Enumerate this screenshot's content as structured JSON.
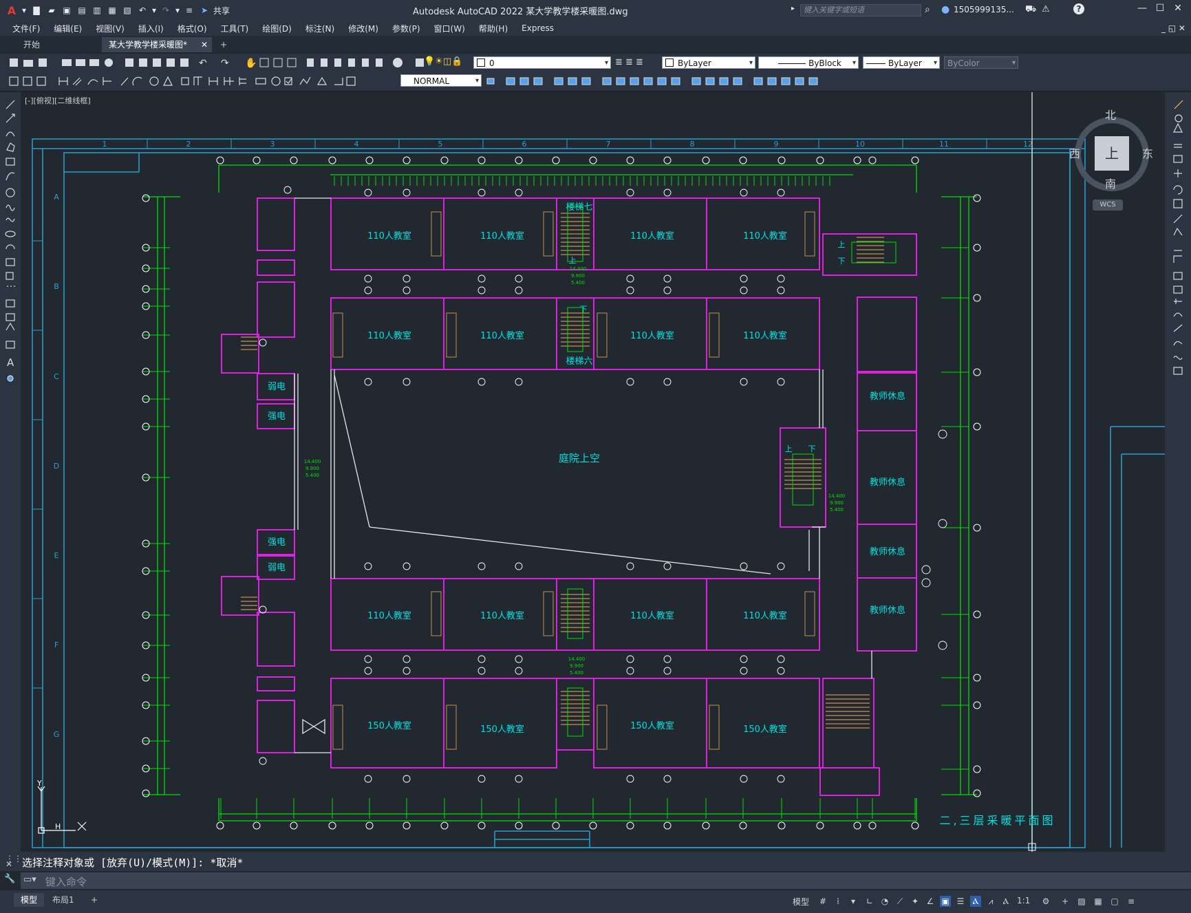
{
  "app": {
    "title": "Autodesk AutoCAD 2022    某大学教学楼采暖图.dwg",
    "logo": "A",
    "share_label": "共享",
    "search_placeholder": "键入关键字或短语",
    "user": "1505999135...",
    "help_icon": "?"
  },
  "menu": [
    "文件(F)",
    "编辑(E)",
    "视图(V)",
    "插入(I)",
    "格式(O)",
    "工具(T)",
    "绘图(D)",
    "标注(N)",
    "修改(M)",
    "参数(P)",
    "窗口(W)",
    "帮助(H)",
    "Express"
  ],
  "tabs": {
    "start": "开始",
    "active": "某大学教学楼采暖图*"
  },
  "properties": {
    "layer": "0",
    "color": "ByLayer",
    "linetype": "ByBlock",
    "lineweight": "ByLayer",
    "plotstyle": "ByColor",
    "visual_style": "NORMAL"
  },
  "viewport": {
    "label": "[-][俯视][二维线框]"
  },
  "viewcube": {
    "north": "北",
    "south": "南",
    "east": "东",
    "west": "西",
    "top": "上",
    "wcs": "WCS"
  },
  "drawing": {
    "column_labels": [
      "1",
      "2",
      "3",
      "4",
      "5",
      "6",
      "7",
      "8",
      "9",
      "10",
      "11",
      "12"
    ],
    "row_labels": [
      "A",
      "B",
      "C",
      "D",
      "E",
      "F",
      "G"
    ],
    "rooms": [
      "110人教室",
      "110人教室",
      "110人教室",
      "110人教室",
      "110人教室",
      "110人教室",
      "110人教室",
      "110人教室",
      "110人教室",
      "110人教室",
      "110人教室",
      "110人教室",
      "150人教室",
      "150人教室",
      "150人教室",
      "150人教室"
    ],
    "stair_7": "楼梯七",
    "stair_6": "楼梯六",
    "courtyard": "庭院上空",
    "electric_weak_1": "弱电",
    "electric_strong_1": "强电",
    "electric_strong_2": "强电",
    "electric_weak_2": "弱电",
    "teacher_rooms": [
      "教师休息",
      "教师休息",
      "教师休息",
      "教师休息"
    ],
    "plan_title": "二,三层采暖平面图",
    "up": "上",
    "down": "下",
    "elev": [
      "14.400",
      "9.900",
      "5.400"
    ]
  },
  "command": {
    "history": "选择注释对象或 [放弃(U)/模式(M)]: *取消*",
    "placeholder": "键入命令"
  },
  "statusbar": {
    "model_tab": "模型",
    "layout_tab": "布局1",
    "model_btn": "模型",
    "scale": "1:1"
  },
  "colors": {
    "wall": "#e020e0",
    "grid": "#00e000",
    "text_cyan": "#00e0e0",
    "frame": "#2aa0d0",
    "stair": "#c89050",
    "accent": "#2f5fa8"
  }
}
